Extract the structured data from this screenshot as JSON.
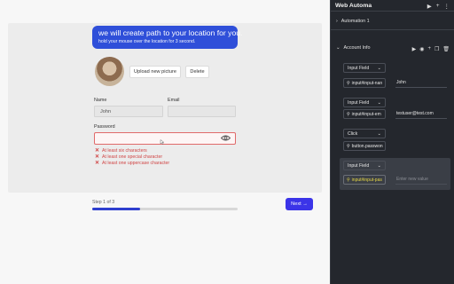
{
  "tooltip": {
    "title": "we will create path to your location for you.",
    "subtitle": "hold your mouse over the location for 3 second."
  },
  "profile": {
    "upload_label": "Upload new picture",
    "delete_label": "Delete"
  },
  "form": {
    "name_label": "Name",
    "name_value": "John",
    "email_label": "Email",
    "email_value": "",
    "password_label": "Password",
    "password_value": "",
    "errors": [
      "At least six characters",
      "At least one special character",
      "At least one uppercase character"
    ]
  },
  "wizard": {
    "step_label": "Step 1 of 3",
    "progress_fraction": 0.33,
    "next_label": "Next →"
  },
  "panel": {
    "title": "Web Automa",
    "groups": [
      {
        "name": "Automation 1",
        "expanded": false
      },
      {
        "name": "Account Info",
        "expanded": true
      }
    ],
    "steps": [
      {
        "type": "Input Field",
        "selector": "input#input-nan",
        "value": "John",
        "placeholder": ""
      },
      {
        "type": "Input Field",
        "selector": "input#input-em",
        "value": "testuser@test.com",
        "placeholder": ""
      },
      {
        "type": "Click",
        "selector": "button.passwon",
        "value": "",
        "placeholder": ""
      },
      {
        "type": "Input Field",
        "selector": "input#input-pas",
        "value": "",
        "placeholder": "Enter new value"
      }
    ]
  },
  "colors": {
    "tooltip_bg": "#2f4fd9",
    "error": "#d04545",
    "next_bg": "#3b34e8",
    "panel_bg": "#24272d",
    "active_selector": "#e6d645"
  }
}
